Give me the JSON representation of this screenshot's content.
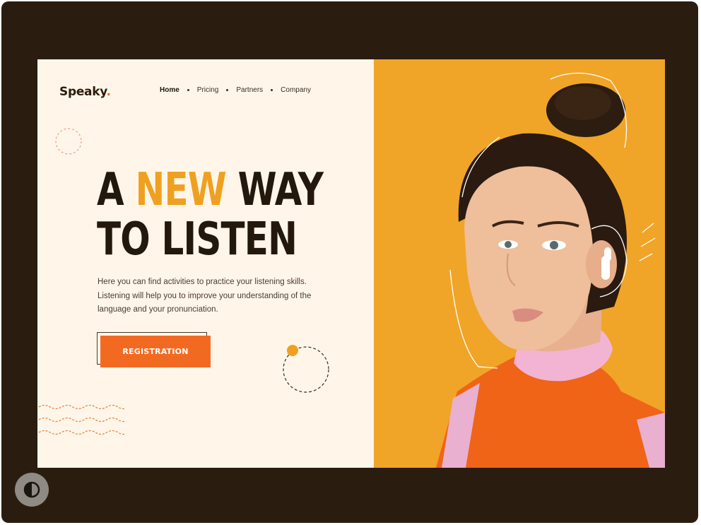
{
  "brand": {
    "name": "Speaky",
    "dot": "."
  },
  "nav": {
    "items": [
      {
        "label": "Home",
        "active": true
      },
      {
        "label": "Pricing",
        "active": false
      },
      {
        "label": "Partners",
        "active": false
      },
      {
        "label": "Company",
        "active": false
      }
    ]
  },
  "hero": {
    "line1_a": "A ",
    "line1_accent": "NEW",
    "line1_b": " WAY",
    "line2": "TO LISTEN"
  },
  "description": "Here you can find activities to practice your listening skills. Listening will help you to improve your understanding of the language and your pronunciation.",
  "cta": {
    "label": "REGISTRATION"
  },
  "icons": {
    "theme_toggle": "contrast-icon"
  },
  "colors": {
    "background_frame": "#2a1d10",
    "page_background": "#fff6e9",
    "accent_orange": "#f26a22",
    "accent_yellow": "#f0a020",
    "photo_background": "#f0a528",
    "text_dark": "#24180c"
  }
}
